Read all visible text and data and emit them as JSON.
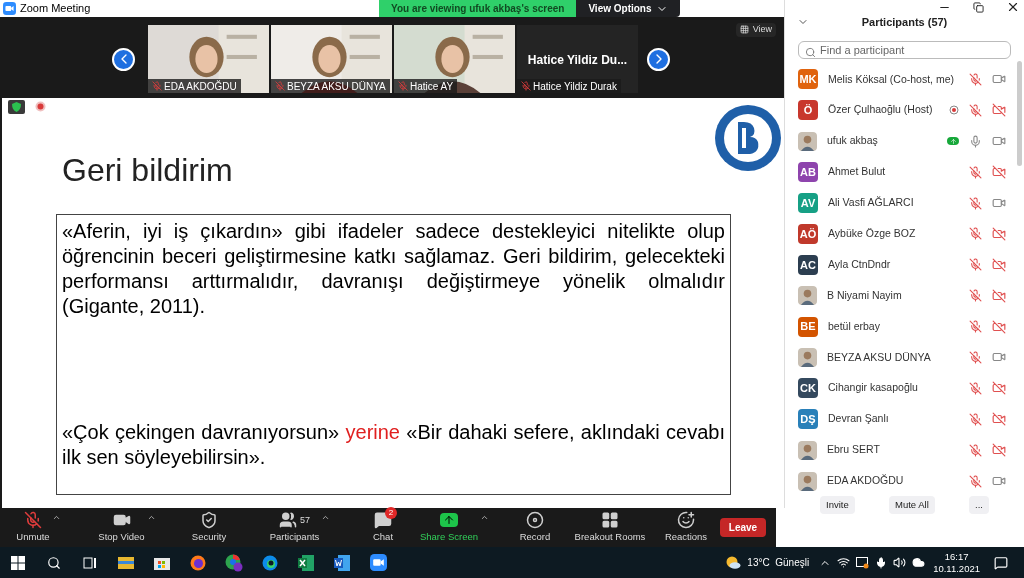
{
  "window": {
    "title": "Zoom Meeting"
  },
  "banner": {
    "text": "You are viewing ufuk akbaş's screen",
    "options": "View Options"
  },
  "video_strip": {
    "view": "View",
    "tiles": [
      {
        "kind": "picture",
        "name": "EDA AKDOĞDU"
      },
      {
        "kind": "picture",
        "name": "BEYZA AKSU DÜNYA"
      },
      {
        "kind": "picture",
        "name": "Hatice AY"
      },
      {
        "kind": "name",
        "title": "Hatice Yildiz Du...",
        "name": "Hatice Yildiz Durak"
      }
    ]
  },
  "slide": {
    "title": "Geri bildirim",
    "paragraphs": [
      [
        {
          "text": "«Aferin, iyi iş çıkardın» gibi ifadeler sadece destekleyici nitelikte olup öğrencinin beceri geliştirmesine katkı sağlamaz. Geri bildirim, gelecekteki performansı arttırmalıdır, davranışı değiştirmeye yönelik olmalıdır  (Gigante, 2011).",
          "highlight": false
        }
      ],
      [
        {
          "text": "«Çok çekingen davranıyorsun» ",
          "highlight": false
        },
        {
          "text": "yerine",
          "highlight": true
        },
        {
          "text": " «Bir dahaki sefere, aklındaki cevabı ilk sen söyleyebilirsin».",
          "highlight": false
        }
      ]
    ]
  },
  "participants_panel": {
    "title": "Participants (57)",
    "search": {
      "placeholder": "Find a participant"
    },
    "participants": [
      {
        "initials": "MK",
        "color": "#e0630e",
        "name": "Melis Köksal (Co-host, me)",
        "mic_muted": true,
        "video_off": false
      },
      {
        "initials": "Ö",
        "color": "#c8372d",
        "name": "Özer Çulhaoğlu (Host)",
        "mic_muted": true,
        "video_off": true,
        "recording": true
      },
      {
        "photo": true,
        "name": "ufuk akbaş",
        "mic_muted": false,
        "video_off": false,
        "sharing": true
      },
      {
        "initials": "AB",
        "color": "#8e44ad",
        "name": "Ahmet Bulut",
        "mic_muted": true,
        "video_off": true
      },
      {
        "initials": "AV",
        "color": "#16a085",
        "name": "Ali Vasfi AĞLARCI",
        "mic_muted": true,
        "video_off": false
      },
      {
        "initials": "AÖ",
        "color": "#c0392b",
        "name": "Aybüke Özge BOZ",
        "mic_muted": true,
        "video_off": true
      },
      {
        "initials": "AC",
        "color": "#2c3e50",
        "name": "Ayla CtnDndr",
        "mic_muted": true,
        "video_off": true
      },
      {
        "photo": true,
        "name": "B Niyami Nayim",
        "mic_muted": true,
        "video_off": true
      },
      {
        "initials": "BE",
        "color": "#d35400",
        "name": "betül erbay",
        "mic_muted": true,
        "video_off": true
      },
      {
        "photo": true,
        "name": "BEYZA AKSU DÜNYA",
        "mic_muted": true,
        "video_off": false
      },
      {
        "initials": "CK",
        "color": "#34495e",
        "name": "Cihangir kasapoğlu",
        "mic_muted": true,
        "video_off": true
      },
      {
        "initials": "DŞ",
        "color": "#2980b9",
        "name": "Devran Şanlı",
        "mic_muted": true,
        "video_off": true
      },
      {
        "photo": true,
        "name": "Ebru SERT",
        "mic_muted": true,
        "video_off": true
      },
      {
        "photo": true,
        "name": "EDA AKDOĞDU",
        "mic_muted": true,
        "video_off": false
      }
    ],
    "buttons": [
      "Invite",
      "Mute All",
      "..."
    ]
  },
  "toolbar": {
    "items": [
      {
        "kind": "mic",
        "label": "Unmute",
        "caret": true
      },
      {
        "kind": "video",
        "label": "Stop Video",
        "caret": true
      },
      {
        "kind": "security",
        "label": "Security"
      },
      {
        "kind": "participants",
        "label": "Participants",
        "count": "57",
        "caret": true
      },
      {
        "kind": "chat",
        "label": "Chat",
        "badge": "2"
      },
      {
        "kind": "share",
        "label": "Share Screen",
        "caret": true
      },
      {
        "kind": "record",
        "label": "Record"
      },
      {
        "kind": "breakout",
        "label": "Breakout Rooms"
      },
      {
        "kind": "reactions",
        "label": "Reactions"
      }
    ],
    "leave": "Leave"
  },
  "taskbar": {
    "weather": "13°C  Güneşli",
    "time": "16:17",
    "date": "10.11.2021"
  }
}
